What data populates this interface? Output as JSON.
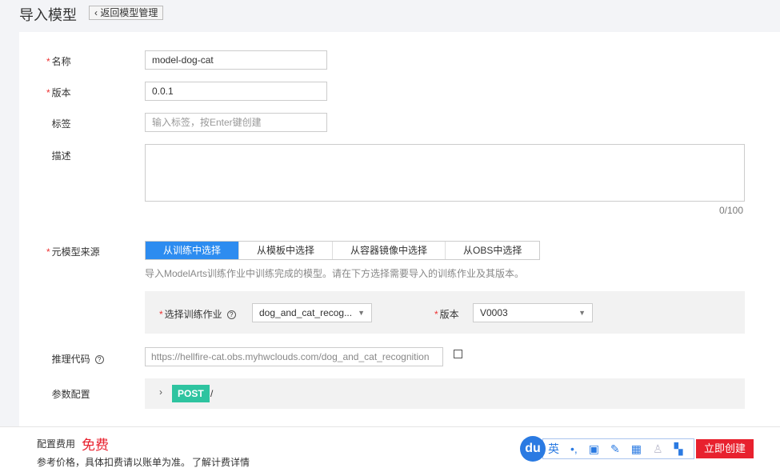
{
  "header": {
    "title": "导入模型",
    "back_label": "返回模型管理"
  },
  "form": {
    "name": {
      "label": "名称",
      "value": "model-dog-cat"
    },
    "version": {
      "label": "版本",
      "value": "0.0.1"
    },
    "tags": {
      "label": "标签",
      "placeholder": "输入标签，按Enter键创建"
    },
    "desc": {
      "label": "描述",
      "counter": "0/100"
    },
    "source": {
      "label": "元模型来源",
      "tabs": [
        "从训练中选择",
        "从模板中选择",
        "从容器镜像中选择",
        "从OBS中选择"
      ],
      "active": 0,
      "hint": "导入ModelArts训练作业中训练完成的模型。请在下方选择需要导入的训练作业及其版本。",
      "job_label": "选择训练作业",
      "job_value": "dog_and_cat_recog...",
      "ver_label": "版本",
      "ver_value": "V0003"
    },
    "code": {
      "label": "推理代码",
      "value": "https://hellfire-cat.obs.myhwclouds.com/dog_and_cat_recognition"
    },
    "params": {
      "label": "参数配置",
      "method": "POST",
      "path": "/"
    }
  },
  "footer": {
    "fee_label": "配置费用",
    "fee_value": "免费",
    "note": "参考价格，具体扣费请以账单为准。",
    "link": "了解计费详情",
    "create": "立即创建"
  },
  "ime": {
    "logo": "du",
    "lang": "英",
    "punct": "•,"
  }
}
